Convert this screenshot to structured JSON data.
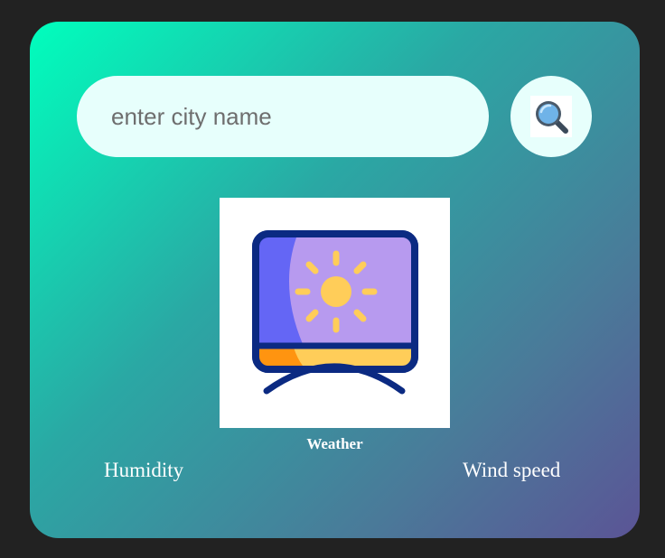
{
  "search": {
    "placeholder": "enter city name",
    "value": "",
    "button_icon": "magnifying-glass-icon"
  },
  "weather": {
    "image_icon": "tv-sun-icon",
    "label": "Weather",
    "humidity_label": "Humidity",
    "wind_speed_label": "Wind speed"
  },
  "colors": {
    "page_background": "#222222",
    "card_gradient_start": "#00ffbd",
    "card_gradient_end": "#5b5496",
    "input_background": "#e7fffc",
    "text": "#ffffff"
  }
}
